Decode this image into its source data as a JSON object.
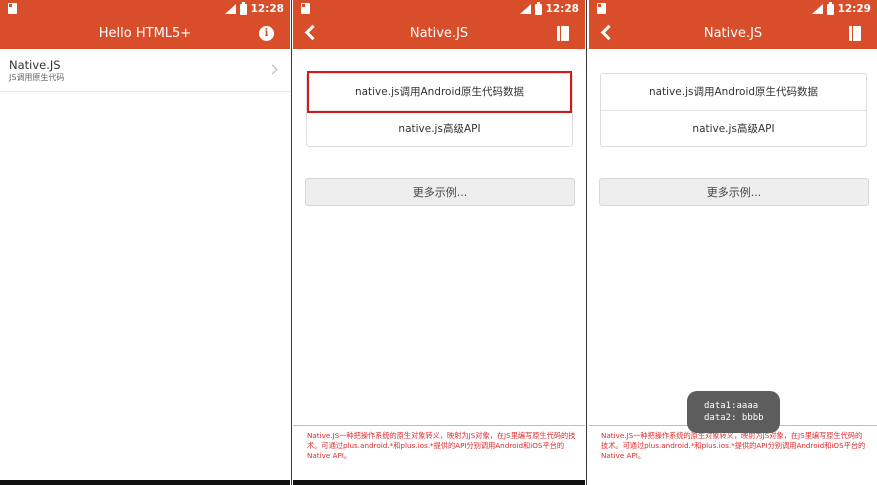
{
  "status_bar": {
    "time_1": "12:28",
    "time_2": "12:28",
    "time_3": "12:29"
  },
  "screen1": {
    "title": "Hello HTML5+",
    "list_item": {
      "title": "Native.JS",
      "subtitle": "JS调用原生代码"
    }
  },
  "screen2": {
    "title": "Native.JS",
    "item1": "native.js调用Android原生代码数据",
    "item2": "native.js高级API",
    "more": "更多示例...",
    "footer": "Native.JS一种把操作系统的原生对象转义，映射为JS对象，在JS里编写原生代码的技术。可通过plus.android.*和plus.ios.*提供的API分别调用Android和iOS平台的Native API。"
  },
  "screen3": {
    "title": "Native.JS",
    "item1": "native.js调用Android原生代码数据",
    "item2": "native.js高级API",
    "more": "更多示例...",
    "footer": "Native.JS一种把操作系统的原生对象转义，映射为JS对象，在JS里编写原生代码的技术。可通过plus.android.*和plus.ios.*提供的API分别调用Android和iOS平台的Native API。",
    "toast_line1": "data1:aaaa",
    "toast_line2": "data2: bbbb"
  },
  "colors": {
    "accent": "#d84d2a",
    "highlight": "#d11a1a",
    "footer_text": "#e02b2b"
  },
  "icons": {
    "back": "chevron-left-icon",
    "info": "info-icon",
    "doc": "document-icon",
    "chevron": "chevron-right-icon"
  }
}
